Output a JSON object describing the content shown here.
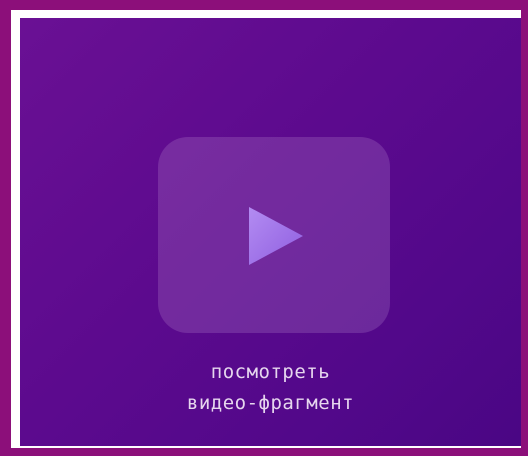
{
  "video": {
    "caption_line1": "посмотреть",
    "caption_line2": "видео-фрагмент",
    "play_icon": "play-icon"
  },
  "colors": {
    "frame": "#8c0f7a",
    "panel": "#5c0a8e",
    "play_triangle": "#a070e8",
    "caption_text": "#e6d6ee"
  }
}
